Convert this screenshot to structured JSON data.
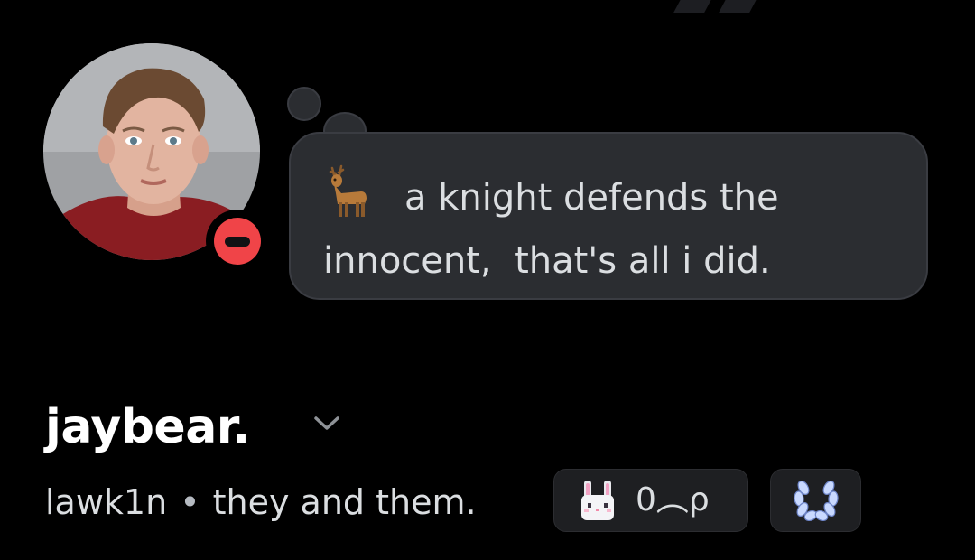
{
  "profile": {
    "display_name": "jaybear.",
    "username": "lawk1n",
    "separator": "•",
    "pronouns": "they and them.",
    "status": "do-not-disturb",
    "status_color": "#f04448"
  },
  "custom_status": {
    "emoji": "deer-emoji",
    "text": "a knight defends the innocent,  that's all i did."
  },
  "clan_tag": {
    "emoji": "bunny-emoji",
    "text": "0︵ρ"
  },
  "badges": [
    {
      "icon": "laurel-wreath-icon",
      "color": "#c9d9ff"
    }
  ],
  "colors": {
    "background": "#000000",
    "bubble": "#2b2d31",
    "badge_bg": "#1e1f22",
    "text_primary": "#ffffff",
    "text_secondary": "#dbdee1"
  }
}
